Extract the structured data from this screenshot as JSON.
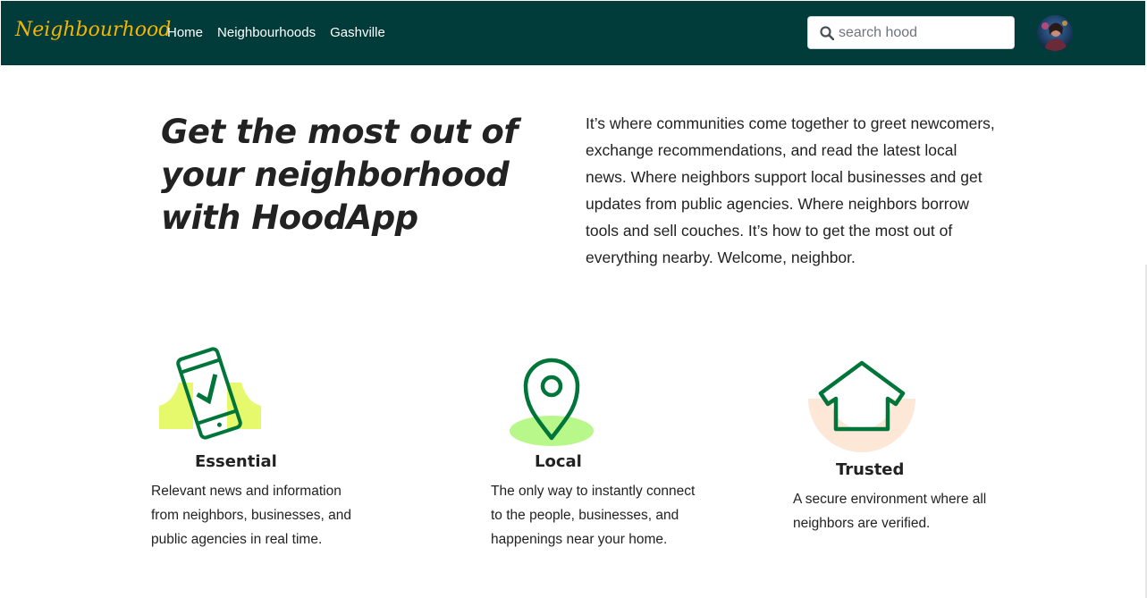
{
  "navbar": {
    "brand": "Neighbourhood",
    "links": [
      "Home",
      "Neighbourhoods",
      "Gashville"
    ],
    "search": {
      "placeholder": "search hood",
      "value": "",
      "icon": "search-icon"
    },
    "avatar": "user-avatar"
  },
  "hero": {
    "title": "Get the most out of your neighborhood with HoodApp",
    "description": "It’s where communities come together to greet newcomers, exchange recommendations, and read the latest local news. Where neighbors support local businesses and get updates from public agencies. Where neighbors borrow tools and sell couches. It’s how to get the most out of everything nearby. Welcome, neighbor."
  },
  "features": [
    {
      "icon": "phone-check-icon",
      "title": "Essential",
      "text": "Relevant news and information from neighbors, businesses, and public agencies in real time."
    },
    {
      "icon": "location-pin-icon",
      "title": "Local",
      "text": "The only way to instantly connect to the people, businesses, and happenings near your home."
    },
    {
      "icon": "house-icon",
      "title": "Trusted",
      "text": "A secure environment where all neighbors are verified."
    }
  ],
  "colors": {
    "navbar_bg": "#013b3a",
    "brand": "#f5b400",
    "icon_green": "#00753a",
    "essential_accent": "#e6f86b",
    "local_accent": "#b8f78a",
    "trusted_accent": "#fde7d6",
    "text": "#222222"
  }
}
